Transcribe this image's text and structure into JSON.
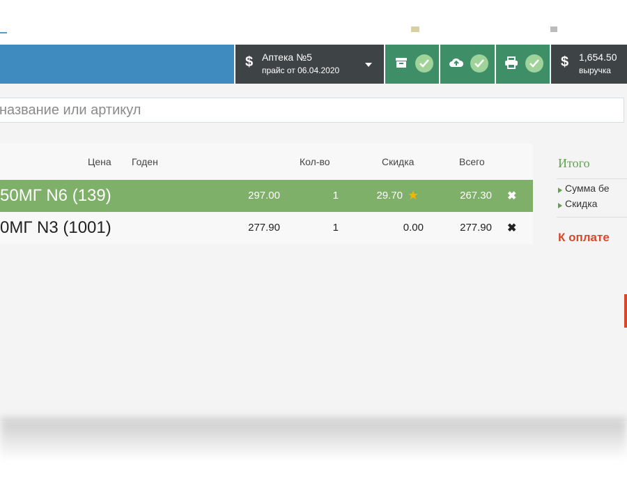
{
  "toolbar": {
    "pharmacy_name": "Аптека №5",
    "price_date": "прайс от 06.04.2020",
    "revenue_value": "1,654.50",
    "revenue_label": "выручка"
  },
  "search": {
    "placeholder": "название или артикул"
  },
  "table": {
    "headers": {
      "price": "Цена",
      "expiry": "Годен",
      "qty": "Кол-во",
      "discount": "Скидка",
      "total": "Всего"
    },
    "rows": [
      {
        "name": "50МГ N6 (139)",
        "price": "297.00",
        "qty": "1",
        "discount": "29.70",
        "total": "267.30",
        "selected": true,
        "discount_star": true
      },
      {
        "name": "0МГ N3 (1001)",
        "price": "277.90",
        "qty": "1",
        "discount": "0.00",
        "total": "277.90",
        "selected": false,
        "discount_star": false
      }
    ],
    "delete_glyph": "✖"
  },
  "summary": {
    "title": "Итого",
    "items": [
      "Сумма бе",
      "Скидка"
    ],
    "to_pay": "К оплате"
  },
  "colors": {
    "toolbar_blue": "#3f8bc0",
    "toolbar_dark": "#3e4345",
    "toolbar_green": "#3e8f68",
    "check_badge": "#9fd39a",
    "selected_row": "#7fb069",
    "summary_title": "#5fa34f",
    "to_pay": "#d9472b",
    "star": "#f4b400"
  },
  "icons": {
    "pharmacy": "dollar-icon",
    "archive": "archive-icon",
    "cloud": "cloud-upload-icon",
    "printer": "printer-icon",
    "revenue": "dollar-icon",
    "status": "check-icon",
    "discount": "star-icon",
    "delete": "close-icon"
  }
}
